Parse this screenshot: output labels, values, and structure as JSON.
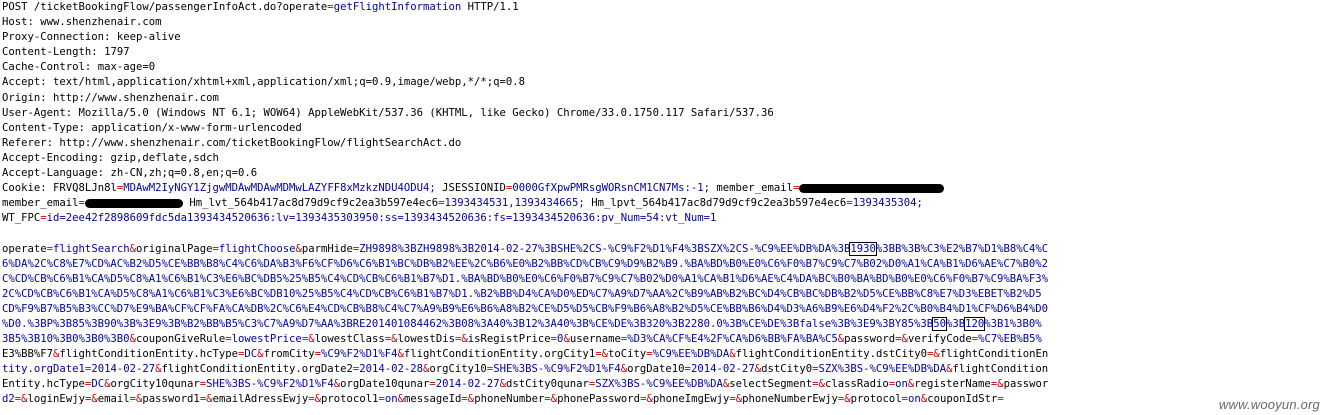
{
  "request": {
    "request_line": {
      "method_path": "POST /ticketBookingFlow/passengerInfoAct.do?",
      "param": "operate",
      "eq": "=",
      "value": "getFlightInformation",
      "proto": " HTTP/1.1"
    },
    "headers": [
      {
        "name": "Host",
        "value": "www.shenzhenair.com"
      },
      {
        "name": "Proxy-Connection",
        "value": "keep-alive"
      },
      {
        "name": "Content-Length",
        "value": "1797"
      },
      {
        "name": "Cache-Control",
        "value": "max-age=0"
      },
      {
        "name": "Accept",
        "value": "text/html,application/xhtml+xml,application/xml;q=0.9,image/webp,*/*;q=0.8"
      },
      {
        "name": "Origin",
        "value": "http://www.shenzhenair.com"
      },
      {
        "name": "User-Agent",
        "value": "Mozilla/5.0 (Windows NT 6.1; WOW64) AppleWebKit/537.36 (KHTML, like Gecko) Chrome/33.0.1750.117 Safari/537.36"
      },
      {
        "name": "Content-Type",
        "value": "application/x-www-form-urlencoded"
      },
      {
        "name": "Referer",
        "value": "http://www.shenzhenair.com/ticketBookingFlow/flightSearchAct.do"
      },
      {
        "name": "Accept-Encoding",
        "value": "gzip,deflate,sdch"
      },
      {
        "name": "Accept-Language",
        "value": "zh-CN,zh;q=0.8,en;q=0.6"
      }
    ],
    "cookie": {
      "label": "Cookie:",
      "c1_name": "FRVQ8LJn8l",
      "c1_value": "MDAwM2IyNGY1ZjgwMDAwMDAwMDMwLAZYFF8xMzkzNDU4ODU4;",
      "c2_name": "JSESSIONID",
      "c2_value": "0000GfXpwPMRsgWORsnCM1CN7Ms:-1;",
      "c3_name": "member_email",
      "c3_sep": "=",
      "l2_name": "member_email",
      "l2_sep": "=",
      "l2_tail": "Hm_lvt_564b417ac8d79d9cf9c2ea3b597e4ec6",
      "l2_tail_value": "1393434531,1393434665;",
      "l2_c5_name": "Hm_lpvt_564b417ac8d79d9cf9c2ea3b597e4ec6",
      "l2_c5_value": "1393435304;",
      "l3_name": "WT_FPC",
      "l3_value": "id=2ee42f2898609fdc5da1393434520636:lv=1393435303950:ss=1393434520636:fs=1393434520636:pv_Num=54:vt_Num=1"
    },
    "body_lines": [
      [
        "operate",
        "=",
        "flightSearch",
        "&",
        "originalPage",
        "=",
        "flightChoose",
        "&",
        "parmHide",
        "=",
        "ZH9898%3BZH9898%3B2014-02-27%3BSHE%2CS-%C9%F2%D1%F4%3BSZX%2CS-%C9%EE%DB%DA%3B",
        "1930",
        "%3BB%3B%C3%E2%B7%D1%B8%C4%C"
      ],
      [
        "6%DA%2C%C8%E7%CD%AC%B2%D5%CE%BB%B8%C4%C6%DA%B3%F6%CF%D6%C6%B1%BC%DB%B2%EE%2C%B6%E0%B2%BB%CD%CB%C9%D9%B2%B9.%BA%BD%B0%E0%C6%F0%B7%C9%C7%B02%D0%A1%CA%B1%D6%AE%C7%B0%2"
      ],
      [
        "C%CD%CB%C6%B1%CA%D5%C8%A1%C6%B1%C3%E6%BC%DB5%25%B5%C4%CD%CB%C6%B1%B7%D1.%BA%BD%B0%E0%C6%F0%B7%C9%C7%B02%D0%A1%CA%B1%D6%AE%C4%DA%BC%B0%BA%BD%B0%E0%C6%F0%B7%C9%BA%F3%"
      ],
      [
        "2C%CD%CB%C6%B1%CA%D5%C8%A1%C6%B1%C3%E6%BC%DB10%25%B5%C4%CD%CB%C6%B1%B7%D1.%B2%BB%D4%CA%D0%ED%C7%A9%D7%AA%2C%B9%AB%B2%BC%D4%CB%BC%DB%B2%D5%CE%BB%C8%E7%D3%EBET%B2%D5"
      ],
      [
        "CD%F9%B7%B5%B3%CC%D7%E9%BA%CF%CF%FA%CA%DB%2C%C6%E4%CD%CB%B8%C4%C7%A9%B9%E6%B6%A8%B2%CE%D5%D5%CB%F9%B6%A8%B2%D5%CE%BB%B6%D4%D3%A6%B9%E6%D4%F2%2C%B0%B4%D1%CF%D6%B4%D0"
      ],
      [
        "%D0.%3BP%3B85%3B90%3B%3E9%3B%B2%BB%B5%C3%C7%A9%D7%AA%3BRE201401084462%3B08%3A40%3B12%3A40%3B%CE%DE%3B320%3B2280.0%3B%CE%DE%3Bfalse%3B%3E9%3BY85%3B",
        "50",
        "%3B",
        "120",
        "%3B1%3B0%"
      ],
      [
        "3B5%3B10%3B0%3B0%3B0",
        "&",
        "couponGiveRule",
        "=",
        "lowestPrice",
        "=",
        "&",
        "lowestClass",
        "=",
        "&",
        "lowestDis",
        "=",
        "&",
        "isRegistPrice",
        "=",
        "0",
        "&",
        "username",
        "=",
        "%D3%CA%CF%E4%2F%CA%D6%BB%FA%BA%C5",
        "&",
        "password",
        "=",
        "&",
        "verifyCode",
        "=",
        "%C7%EB%B5%"
      ],
      [
        "E3%BB%F7",
        "&",
        "flightConditionEntity.hcType",
        "=",
        "DC",
        "&",
        "fromCity",
        "=",
        "%C9%F2%D1%F4",
        "&",
        "flightConditionEntity.orgCity1",
        "=",
        "&",
        "toCity",
        "=",
        "%C9%EE%DB%DA",
        "&",
        "flightConditionEntity.dstCity0",
        "=",
        "&",
        "flightConditionEn"
      ],
      [
        "tity.orgDate1",
        "=",
        "2014-02-27",
        "&",
        "flightConditionEntity.orgDate2",
        "=",
        "2014-02-28",
        "&",
        "orgCity10",
        "=",
        "SHE%3BS-%C9%F2%D1%F4",
        "&",
        "orgDate10",
        "=",
        "2014-02-27",
        "&",
        "dstCity0",
        "=",
        "SZX%3BS-%C9%EE%DB%DA",
        "&",
        "flightCondition"
      ],
      [
        "Entity.hcType",
        "=",
        "DC",
        "&",
        "orgCity10qunar",
        "=",
        "SHE%3BS-%C9%F2%D1%F4",
        "&",
        "orgDate10qunar",
        "=",
        "2014-02-27",
        "&",
        "dstCity0qunar",
        "=",
        "SZX%3BS-%C9%EE%DB%DA",
        "&",
        "selectSegment",
        "=",
        "&",
        "classRadio",
        "=",
        "on",
        "&",
        "registerName",
        "=",
        "&",
        "passwor"
      ],
      [
        "d2",
        "=",
        "&",
        "loginEwjy",
        "=",
        "&",
        "email",
        "=",
        "&",
        "password1",
        "=",
        "&",
        "emailAdressEwjy",
        "=",
        "&",
        "protocol1",
        "=",
        "on",
        "&",
        "messageId",
        "=",
        "&",
        "phoneNumber",
        "=",
        "&",
        "phonePassword",
        "=",
        "&",
        "phoneImgEwjy",
        "=",
        "&",
        "phoneNumberEwjy",
        "=",
        "&",
        "protocol",
        "=",
        "on",
        "&",
        "couponIdStr",
        "="
      ]
    ]
  },
  "watermark": "www.wooyun.org",
  "colors": {
    "name": "#000000",
    "value": "#0000a0",
    "punct": "#cc0000"
  }
}
